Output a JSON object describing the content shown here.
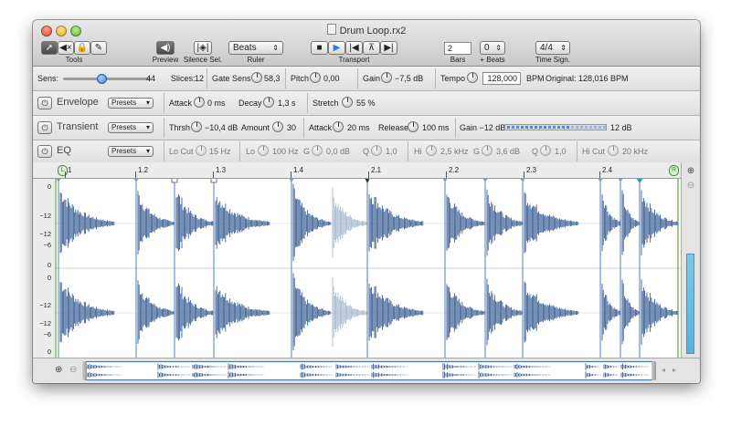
{
  "window": {
    "title": "Drum Loop.rx2"
  },
  "toolbar": {
    "tools_label": "Tools",
    "preview_label": "Preview",
    "silence_sel_label": "Silence Sel.",
    "ruler_label": "Ruler",
    "ruler_value": "Beats",
    "transport_label": "Transport",
    "bars_label": "Bars",
    "bars_value": "2",
    "beats_label": "+ Beats",
    "beats_value": "0",
    "time_sign_label": "Time Sign.",
    "time_sign_value": "4/4"
  },
  "slice_bar": {
    "sens_label": "Sens:",
    "sens_value": "44",
    "sens_level": 0.44,
    "slices_label": "Slices:",
    "slices_value": "12",
    "gate_sens_label": "Gate Sens",
    "gate_sens_value": "58,3",
    "pitch_label": "Pitch",
    "pitch_value": "0,00",
    "gain_label": "Gain",
    "gain_value": "−7,5 dB",
    "tempo_label": "Tempo",
    "tempo_value": "128,000",
    "bpm_label": "BPM",
    "original_label": "Original: 128,016 BPM"
  },
  "envelope": {
    "label": "Envelope",
    "presets": "Presets",
    "attack_label": "Attack",
    "attack_value": "0 ms",
    "decay_label": "Decay",
    "decay_value": "1,3 s",
    "stretch_label": "Stretch",
    "stretch_value": "55 %"
  },
  "transient": {
    "label": "Transient",
    "presets": "Presets",
    "thrsh_label": "Thrsh",
    "thrsh_value": "−10,4 dB",
    "amount_label": "Amount",
    "amount_value": "30",
    "attack_label": "Attack",
    "attack_value": "20 ms",
    "release_label": "Release",
    "release_value": "100 ms",
    "gain_label": "Gain −12 dB",
    "gain_right": "12 dB"
  },
  "eq": {
    "label": "EQ",
    "presets": "Presets",
    "locut_label": "Lo Cut",
    "locut_value": "15 Hz",
    "lo_label": "Lo",
    "lo_value": "100 Hz",
    "g1_label": "G",
    "g1_value": "0,0 dB",
    "q1_label": "Q",
    "q1_value": "1,0",
    "hi_label": "Hi",
    "hi_value": "2,5 kHz",
    "g2_label": "G",
    "g2_value": "3,6 dB",
    "q2_label": "Q",
    "q2_value": "1,0",
    "hicut_label": "Hi Cut",
    "hicut_value": "20 kHz"
  },
  "ruler": {
    "start_marker": "L",
    "end_marker": "R",
    "ticks": [
      "1",
      "1.2",
      "1.3",
      "1.4",
      "2.1",
      "2.2",
      "2.3",
      "2.4"
    ]
  },
  "axis": {
    "top": [
      "0",
      "−12",
      "−12",
      "−6",
      "0"
    ],
    "bottom": [
      "0",
      "−12",
      "−12",
      "−6",
      "0"
    ]
  },
  "colors": {
    "wave": "#3c5f93",
    "wave_dim": "#a9b8cf",
    "slice_line": "#4d7fc4",
    "accent": "#3a8fe0"
  }
}
